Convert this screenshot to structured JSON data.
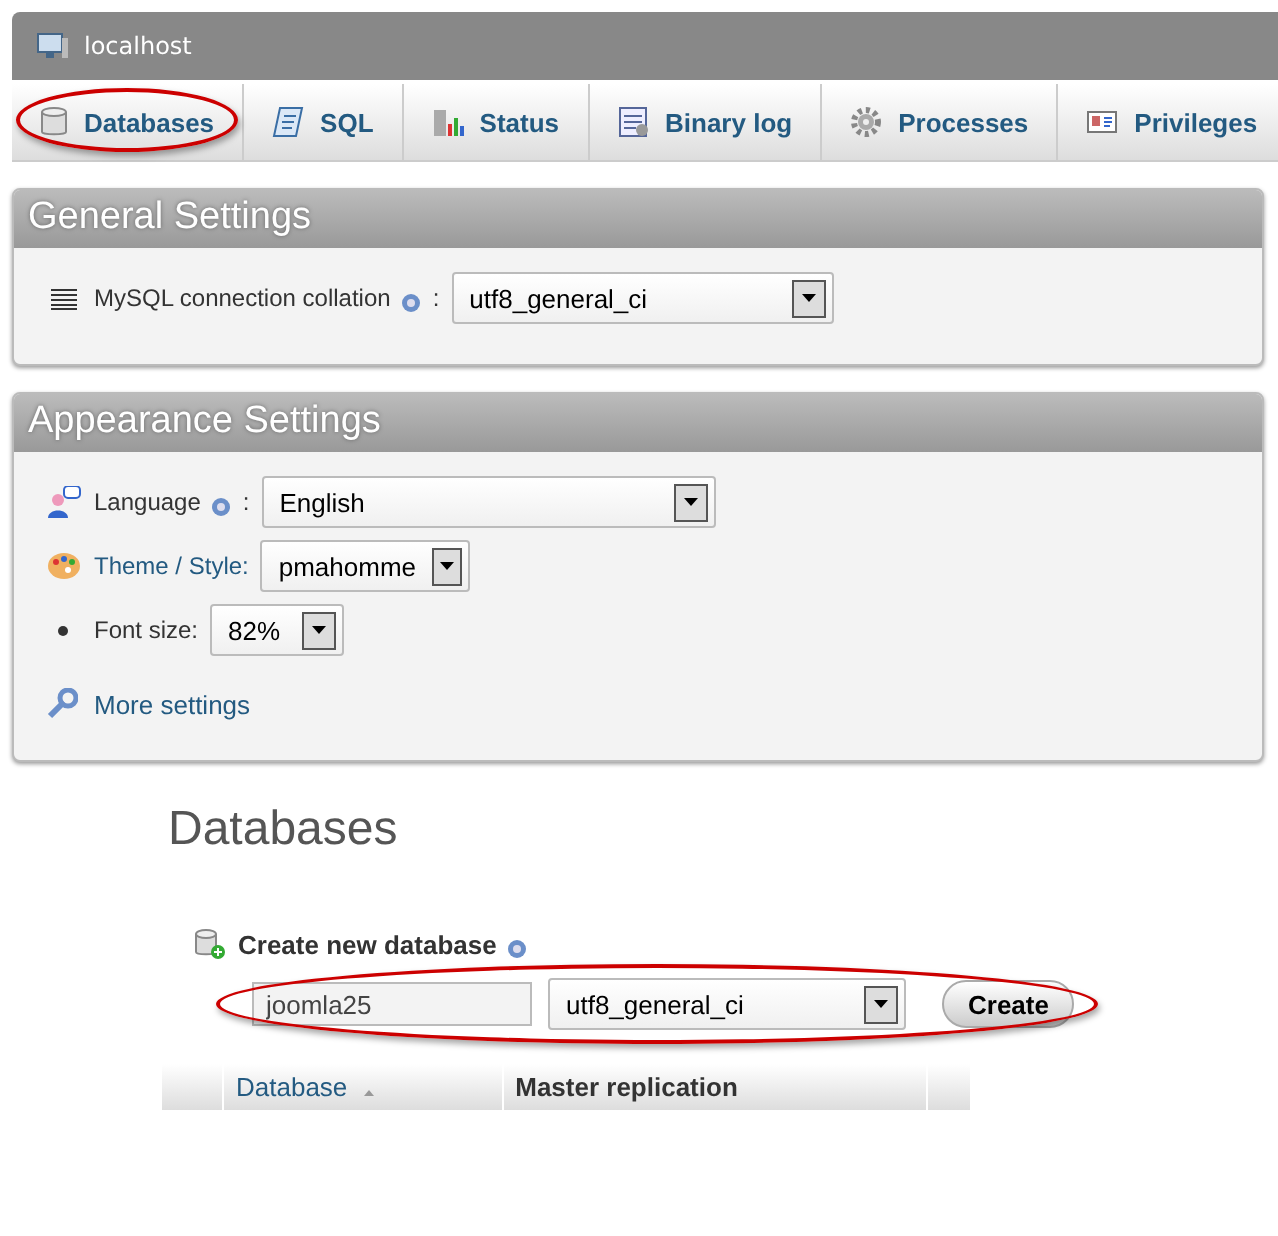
{
  "server": {
    "title": "localhost"
  },
  "tabs": [
    {
      "label": "Databases",
      "kind": "database",
      "selected": false,
      "highlighted": true
    },
    {
      "label": "SQL",
      "kind": "sql",
      "selected": false,
      "highlighted": false
    },
    {
      "label": "Status",
      "kind": "status",
      "selected": false,
      "highlighted": false
    },
    {
      "label": "Binary log",
      "kind": "log",
      "selected": false,
      "highlighted": false
    },
    {
      "label": "Processes",
      "kind": "gear",
      "selected": false,
      "highlighted": false
    },
    {
      "label": "Privileges",
      "kind": "card",
      "selected": false,
      "highlighted": false
    }
  ],
  "general_settings": {
    "title": "General Settings",
    "rows": [
      {
        "kind": "list",
        "label": "MySQL connection collation",
        "link": false,
        "help": true,
        "suffix": ":",
        "value": "utf8_general_ci"
      }
    ]
  },
  "appearance_settings": {
    "title": "Appearance Settings",
    "rows": [
      {
        "kind": "language",
        "label": "Language",
        "link": false,
        "help": true,
        "suffix": ":",
        "value": "English"
      },
      {
        "kind": "palette",
        "label": "Theme / Style:",
        "link": true,
        "help": false,
        "value": "pmahomme"
      },
      {
        "kind": "bullet",
        "label": "Font size:",
        "link": false,
        "help": false,
        "value": "82%"
      }
    ],
    "more_link": "More settings"
  },
  "databases": {
    "heading": "Databases",
    "create": {
      "label": "Create new database",
      "help": true,
      "name": "joomla25",
      "collation": "utf8_general_ci",
      "button": "Create",
      "highlighted": true
    },
    "columns": [
      {
        "label": "Database",
        "link": true,
        "sorted": true
      },
      {
        "label": "Master replication",
        "link": false,
        "sorted": false
      }
    ]
  }
}
